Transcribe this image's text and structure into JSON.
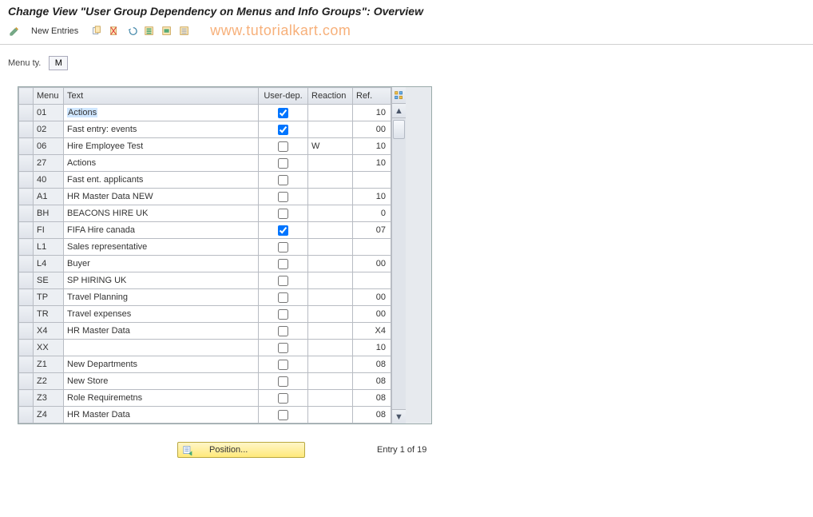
{
  "title": "Change View \"User Group Dependency on Menus and Info Groups\": Overview",
  "toolbar": {
    "new_entries": "New Entries"
  },
  "watermark": "www.tutorialkart.com",
  "filter": {
    "label": "Menu ty.",
    "value": "M"
  },
  "columns": {
    "menu": "Menu",
    "text": "Text",
    "userdep": "User-dep.",
    "reaction": "Reaction",
    "ref": "Ref."
  },
  "rows": [
    {
      "menu": "01",
      "text": "Actions",
      "userdep": true,
      "reaction": "",
      "ref": "10",
      "highlight": true
    },
    {
      "menu": "02",
      "text": "Fast entry: events",
      "userdep": true,
      "reaction": "",
      "ref": "00"
    },
    {
      "menu": "06",
      "text": "Hire Employee Test",
      "userdep": false,
      "reaction": "W",
      "ref": "10"
    },
    {
      "menu": "27",
      "text": "Actions",
      "userdep": false,
      "reaction": "",
      "ref": "10"
    },
    {
      "menu": "40",
      "text": "Fast ent. applicants",
      "userdep": false,
      "reaction": "",
      "ref": ""
    },
    {
      "menu": "A1",
      "text": "HR Master Data NEW",
      "userdep": false,
      "reaction": "",
      "ref": "10"
    },
    {
      "menu": "BH",
      "text": "BEACONS HIRE UK",
      "userdep": false,
      "reaction": "",
      "ref": "0"
    },
    {
      "menu": "FI",
      "text": "FIFA Hire canada",
      "userdep": true,
      "reaction": "",
      "ref": "07"
    },
    {
      "menu": "L1",
      "text": "Sales representative",
      "userdep": false,
      "reaction": "",
      "ref": ""
    },
    {
      "menu": "L4",
      "text": "Buyer",
      "userdep": false,
      "reaction": "",
      "ref": "00"
    },
    {
      "menu": "SE",
      "text": "SP HIRING UK",
      "userdep": false,
      "reaction": "",
      "ref": ""
    },
    {
      "menu": "TP",
      "text": "Travel Planning",
      "userdep": false,
      "reaction": "",
      "ref": "00"
    },
    {
      "menu": "TR",
      "text": "Travel expenses",
      "userdep": false,
      "reaction": "",
      "ref": "00"
    },
    {
      "menu": "X4",
      "text": "HR Master Data",
      "userdep": false,
      "reaction": "",
      "ref": "X4"
    },
    {
      "menu": "XX",
      "text": "",
      "userdep": false,
      "reaction": "",
      "ref": "10"
    },
    {
      "menu": "Z1",
      "text": "New Departments",
      "userdep": false,
      "reaction": "",
      "ref": "08"
    },
    {
      "menu": "Z2",
      "text": "New Store",
      "userdep": false,
      "reaction": "",
      "ref": "08"
    },
    {
      "menu": "Z3",
      "text": "Role Requiremetns",
      "userdep": false,
      "reaction": "",
      "ref": "08"
    },
    {
      "menu": "Z4",
      "text": "HR Master Data",
      "userdep": false,
      "reaction": "",
      "ref": "08"
    }
  ],
  "footer": {
    "position_label": "Position...",
    "entry_text": "Entry 1 of 19"
  }
}
